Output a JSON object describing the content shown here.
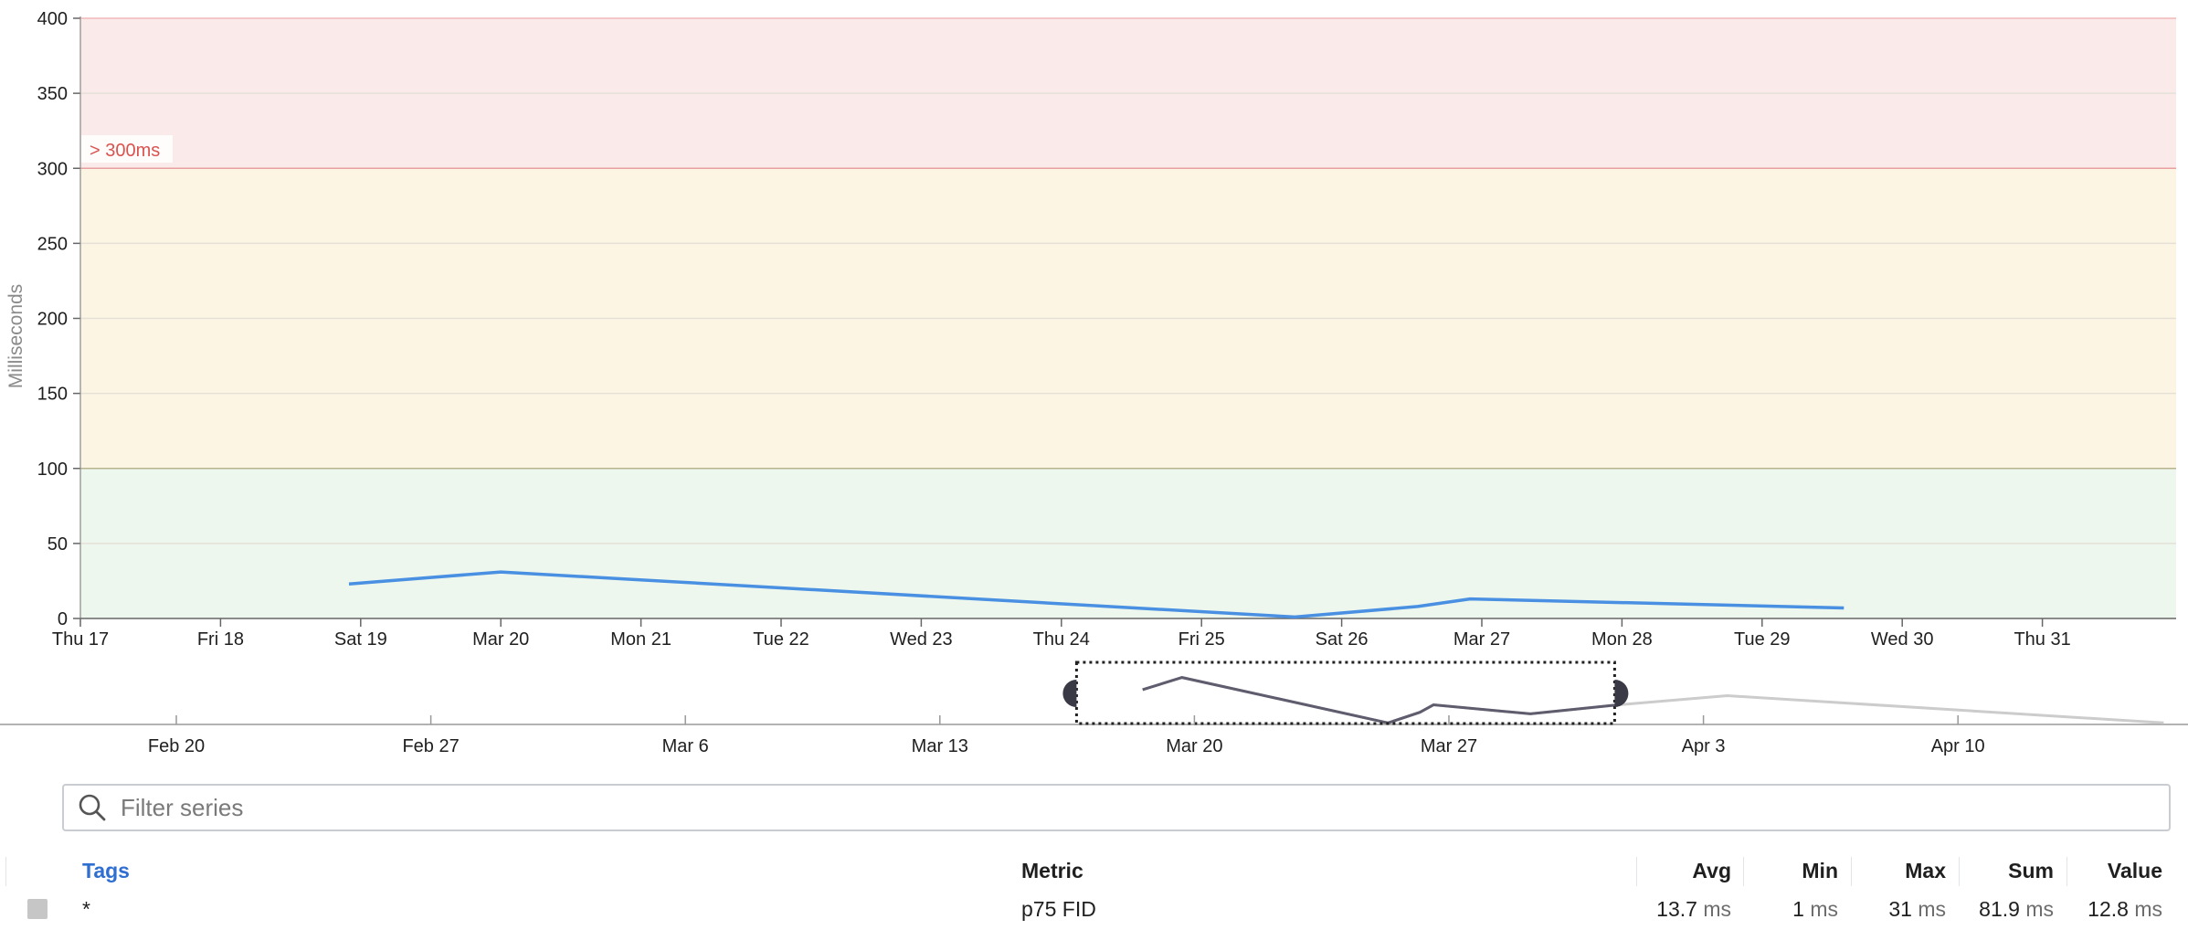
{
  "chart_data": {
    "type": "line",
    "ylabel": "Milliseconds",
    "ylim": [
      0,
      400
    ],
    "y_ticks": [
      "0",
      "50",
      "100",
      "150",
      "200",
      "250",
      "300",
      "350",
      "400"
    ],
    "x_tick_labels": [
      "Thu 17",
      "Fri 18",
      "Sat 19",
      "Mar 20",
      "Mon 21",
      "Tue 22",
      "Wed 23",
      "Thu 24",
      "Fri 25",
      "Sat 26",
      "Mar 27",
      "Mon 28",
      "Tue 29",
      "Wed 30",
      "Thu 31"
    ],
    "x_range": [
      "2022-03-17",
      "2022-04-01"
    ],
    "bands": [
      {
        "from": 0,
        "to": 100,
        "color": "#edf7ee",
        "line_color": "#b7b38c"
      },
      {
        "from": 100,
        "to": 300,
        "color": "#fdf5e3",
        "line_color": "#e59a9a"
      },
      {
        "from": 300,
        "to": 400,
        "color": "#faeaea",
        "line_color": "#e9a9a9"
      }
    ],
    "threshold_label": "> 300ms",
    "threshold_color": "#d9534f",
    "series": [
      {
        "name": "p75 FID",
        "color": "#4a90e2",
        "points": [
          {
            "x": "2022-03-18 22:00",
            "y": 23
          },
          {
            "x": "2022-03-20 00:00",
            "y": 31
          },
          {
            "x": "2022-03-25 16:00",
            "y": 1
          },
          {
            "x": "2022-03-26 13:00",
            "y": 8
          },
          {
            "x": "2022-03-26 22:00",
            "y": 13
          },
          {
            "x": "2022-03-29 14:00",
            "y": 7
          }
        ]
      }
    ],
    "navigator": {
      "x_tick_labels": [
        "Feb 20",
        "Feb 27",
        "Mar 6",
        "Mar 13",
        "Mar 20",
        "Mar 27",
        "Apr 3",
        "Apr 10"
      ],
      "x_range": [
        "2022-02-17",
        "2022-04-16"
      ],
      "selected_range": [
        "2022-03-17",
        "2022-04-01"
      ],
      "line_color_selected": "#5f5c6e",
      "line_color_outside": "#cccccc",
      "points": [
        {
          "x": "2022-03-18 22:00",
          "y": 23
        },
        {
          "x": "2022-03-20 00:00",
          "y": 31
        },
        {
          "x": "2022-03-25 16:00",
          "y": 1
        },
        {
          "x": "2022-03-26 13:00",
          "y": 8
        },
        {
          "x": "2022-03-26 22:00",
          "y": 13
        },
        {
          "x": "2022-03-29 14:00",
          "y": 7
        },
        {
          "x": "2022-04-01 00:00",
          "y": 13
        },
        {
          "x": "2022-04-04 00:00",
          "y": 19
        },
        {
          "x": "2022-04-16 00:00",
          "y": 1
        }
      ]
    }
  },
  "filter": {
    "placeholder": "Filter series",
    "icon": "search-icon"
  },
  "table": {
    "headers": {
      "tags": "Tags",
      "metric": "Metric",
      "avg": "Avg",
      "min": "Min",
      "max": "Max",
      "sum": "Sum",
      "value": "Value"
    },
    "rows": [
      {
        "tags": "*",
        "metric": "p75 FID",
        "avg": "13.7",
        "min": "1",
        "max": "31",
        "sum": "81.9",
        "value": "12.8",
        "unit": "ms",
        "swatch_color": "#c6c6c6"
      }
    ]
  }
}
